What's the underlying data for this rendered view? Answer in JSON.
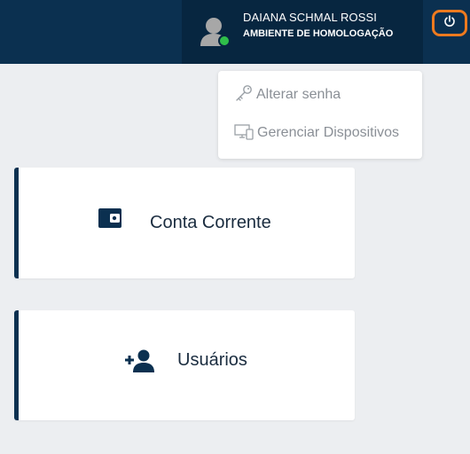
{
  "header": {
    "user_name": "DAIANA SCHMAL ROSSI",
    "environment": "AMBIENTE DE HOMOLOGAÇÃO",
    "avatar_icon": "user-avatar-icon",
    "status_icon": "online-status-dot",
    "power_icon": "power-icon",
    "colors": {
      "header_bg": "#0b3050",
      "user_block_bg": "#072640",
      "power_border": "#ee7a1f",
      "status_online": "#2fbf4a"
    }
  },
  "user_menu": {
    "items": [
      {
        "label": "Alterar senha",
        "icon": "key-icon"
      },
      {
        "label": "Gerenciar Dispositivos",
        "icon": "devices-icon"
      }
    ]
  },
  "cards": [
    {
      "label": "Conta Corrente",
      "icon": "wallet-icon"
    },
    {
      "label": "Usuários",
      "icon": "add-user-icon"
    }
  ]
}
